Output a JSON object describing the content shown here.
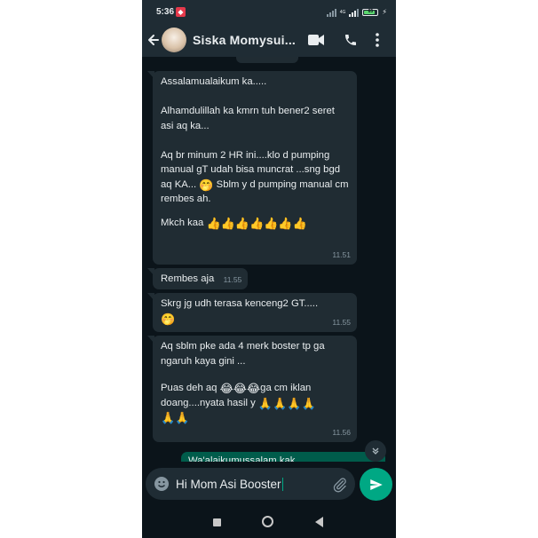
{
  "status_bar": {
    "time": "5:36",
    "battery": "65"
  },
  "header": {
    "contact_name": "Siska Momysui..."
  },
  "messages": [
    {
      "text": "Assalamualaikum ka.....\n\nAlhamdulillah ka kmrn tuh bener2 seret asi aq ka...\n\nAq br minum 2 HR ini....klo d pumping manual gT udah bisa muncrat ...sng bgd aq KA...",
      "emoji_inline": "🤭",
      "text_after": "Sblm y d pumping manual cm rembes ah.",
      "line2": "Mkch kaa",
      "emoji_line": "👍👍👍👍👍👍👍",
      "time": "11.51"
    },
    {
      "text": "Rembes aja",
      "time": "11.55"
    },
    {
      "text": "Skrg jg udh terasa kenceng2 GT.....",
      "emoji_line": "🤭",
      "time": "11.55"
    },
    {
      "text": "Aq sblm pke ada 4 merk boster tp ga ngaruh kaya gini ...",
      "line2": "Puas deh aq",
      "emoji_inline": "😂😂😂",
      "text_after": "ga cm iklan doang....nyata hasil y",
      "emoji_after": "🙏🙏🙏🙏",
      "emoji_line": "🙏🙏",
      "time": "11.56"
    }
  ],
  "outgoing": {
    "text": "Wa'alaikumussalam kak"
  },
  "input": {
    "value": "Hi Mom Asi Booster"
  },
  "colors": {
    "header_bg": "#1f2c34",
    "chat_bg": "#0b141a",
    "incoming_bubble": "#202c33",
    "outgoing_bubble": "#005c4b",
    "accent": "#00a884"
  }
}
